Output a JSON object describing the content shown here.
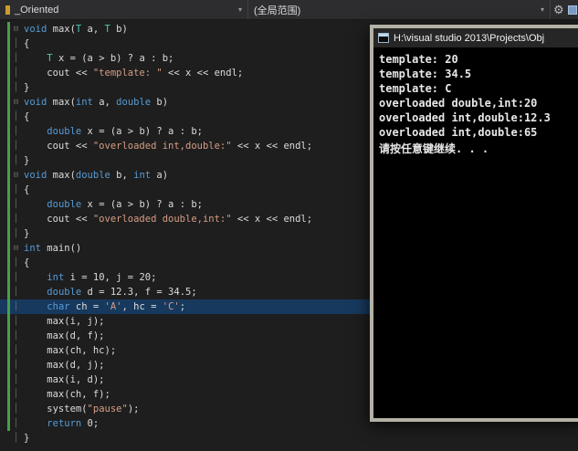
{
  "palette": {
    "navbar_bg": "#2d2d30",
    "editor_bg": "#1e1e1e",
    "keyword": "#569cd6",
    "type": "#4ec9b0",
    "string": "#d69d85",
    "plain": "#dcdcdc",
    "change_bar": "#45a04a",
    "line_highlight": "#17395e",
    "console_bg": "#000000",
    "console_text": "#e8e8e8",
    "console_border": "#b3b0a5",
    "console_titlebar": "#262626"
  },
  "navbar": {
    "member_dropdown": {
      "label": "_Oriented"
    },
    "scope_dropdown": {
      "label": "(全局范围)"
    },
    "dropdown_arrow": "▾",
    "gear_glyph": "⚙"
  },
  "editor": {
    "lines": [
      {
        "g": "⊟",
        "cb": 1,
        "hl": 0,
        "seg": [
          [
            "void",
            "k"
          ],
          [
            " max(",
            "p"
          ],
          [
            "T",
            "y"
          ],
          [
            " a, ",
            "p"
          ],
          [
            "T",
            "y"
          ],
          [
            " b)",
            "p"
          ]
        ]
      },
      {
        "g": "│",
        "cb": 1,
        "hl": 0,
        "seg": [
          [
            "{",
            "p"
          ]
        ]
      },
      {
        "g": "│",
        "cb": 1,
        "hl": 0,
        "seg": [
          [
            "    ",
            "p"
          ],
          [
            "T",
            "y"
          ],
          [
            " x = (a > b) ? a : b;",
            "p"
          ]
        ]
      },
      {
        "g": "│",
        "cb": 1,
        "hl": 0,
        "seg": [
          [
            "    cout << ",
            "p"
          ],
          [
            "\"template: \"",
            "s"
          ],
          [
            " << x << endl;",
            "p"
          ]
        ]
      },
      {
        "g": "│",
        "cb": 1,
        "hl": 0,
        "seg": [
          [
            "}",
            "p"
          ]
        ]
      },
      {
        "g": "⊟",
        "cb": 1,
        "hl": 0,
        "seg": [
          [
            "void",
            "k"
          ],
          [
            " max(",
            "p"
          ],
          [
            "int",
            "k"
          ],
          [
            " a, ",
            "p"
          ],
          [
            "double",
            "k"
          ],
          [
            " b)",
            "p"
          ]
        ]
      },
      {
        "g": "│",
        "cb": 1,
        "hl": 0,
        "seg": [
          [
            "{",
            "p"
          ]
        ]
      },
      {
        "g": "│",
        "cb": 1,
        "hl": 0,
        "seg": [
          [
            "    ",
            "p"
          ],
          [
            "double",
            "k"
          ],
          [
            " x = (a > b) ? a : b;",
            "p"
          ]
        ]
      },
      {
        "g": "│",
        "cb": 1,
        "hl": 0,
        "seg": [
          [
            "    cout << ",
            "p"
          ],
          [
            "\"overloaded int,double:\"",
            "s"
          ],
          [
            " << x << endl;",
            "p"
          ]
        ]
      },
      {
        "g": "│",
        "cb": 1,
        "hl": 0,
        "seg": [
          [
            "}",
            "p"
          ]
        ]
      },
      {
        "g": "⊟",
        "cb": 1,
        "hl": 0,
        "seg": [
          [
            "void",
            "k"
          ],
          [
            " max(",
            "p"
          ],
          [
            "double",
            "k"
          ],
          [
            " b, ",
            "p"
          ],
          [
            "int",
            "k"
          ],
          [
            " a)",
            "p"
          ]
        ]
      },
      {
        "g": "│",
        "cb": 1,
        "hl": 0,
        "seg": [
          [
            "{",
            "p"
          ]
        ]
      },
      {
        "g": "│",
        "cb": 1,
        "hl": 0,
        "seg": [
          [
            "    ",
            "p"
          ],
          [
            "double",
            "k"
          ],
          [
            " x = (a > b) ? a : b;",
            "p"
          ]
        ]
      },
      {
        "g": "│",
        "cb": 1,
        "hl": 0,
        "seg": [
          [
            "    cout << ",
            "p"
          ],
          [
            "\"overloaded double,int:\"",
            "s"
          ],
          [
            " << x << endl;",
            "p"
          ]
        ]
      },
      {
        "g": "│",
        "cb": 1,
        "hl": 0,
        "seg": [
          [
            "}",
            "p"
          ]
        ]
      },
      {
        "g": "⊟",
        "cb": 1,
        "hl": 0,
        "seg": [
          [
            "int",
            "k"
          ],
          [
            " main()",
            "p"
          ]
        ]
      },
      {
        "g": "│",
        "cb": 1,
        "hl": 0,
        "seg": [
          [
            "{",
            "p"
          ]
        ]
      },
      {
        "g": "│",
        "cb": 1,
        "hl": 0,
        "seg": [
          [
            "    ",
            "p"
          ],
          [
            "int",
            "k"
          ],
          [
            " i = 10, j = 20;",
            "p"
          ]
        ]
      },
      {
        "g": "│",
        "cb": 1,
        "hl": 0,
        "seg": [
          [
            "    ",
            "p"
          ],
          [
            "double",
            "k"
          ],
          [
            " d = 12.3, f = 34.5;",
            "p"
          ]
        ]
      },
      {
        "g": "│",
        "cb": 1,
        "hl": 1,
        "seg": [
          [
            "    ",
            "p"
          ],
          [
            "char",
            "k"
          ],
          [
            " ch = ",
            "p"
          ],
          [
            "'A'",
            "s"
          ],
          [
            ", hc = ",
            "p"
          ],
          [
            "'C'",
            "s"
          ],
          [
            ";",
            "p"
          ]
        ]
      },
      {
        "g": "│",
        "cb": 1,
        "hl": 0,
        "seg": [
          [
            "    max(i, j);",
            "p"
          ]
        ]
      },
      {
        "g": "│",
        "cb": 1,
        "hl": 0,
        "seg": [
          [
            "    max(d, f);",
            "p"
          ]
        ]
      },
      {
        "g": "│",
        "cb": 1,
        "hl": 0,
        "seg": [
          [
            "    max(ch, hc);",
            "p"
          ]
        ]
      },
      {
        "g": "│",
        "cb": 1,
        "hl": 0,
        "seg": [
          [
            "    max(d, j);",
            "p"
          ]
        ]
      },
      {
        "g": "│",
        "cb": 1,
        "hl": 0,
        "seg": [
          [
            "    max(i, d);",
            "p"
          ]
        ]
      },
      {
        "g": "│",
        "cb": 1,
        "hl": 0,
        "seg": [
          [
            "    max(ch, f);",
            "p"
          ]
        ]
      },
      {
        "g": "│",
        "cb": 1,
        "hl": 0,
        "seg": [
          [
            "    system(",
            "p"
          ],
          [
            "\"pause\"",
            "s"
          ],
          [
            ");",
            "p"
          ]
        ]
      },
      {
        "g": "│",
        "cb": 1,
        "hl": 0,
        "seg": [
          [
            "    ",
            "p"
          ],
          [
            "return",
            "k"
          ],
          [
            " 0;",
            "p"
          ]
        ]
      },
      {
        "g": "│",
        "cb": 0,
        "hl": 0,
        "seg": [
          [
            "}",
            "p"
          ]
        ]
      }
    ]
  },
  "console": {
    "title": "H:\\visual studio 2013\\Projects\\Obj",
    "lines": [
      "template: 20",
      "template: 34.5",
      "template: C",
      "overloaded double,int:20",
      "overloaded int,double:12.3",
      "overloaded int,double:65",
      "请按任意键继续. . ."
    ]
  }
}
